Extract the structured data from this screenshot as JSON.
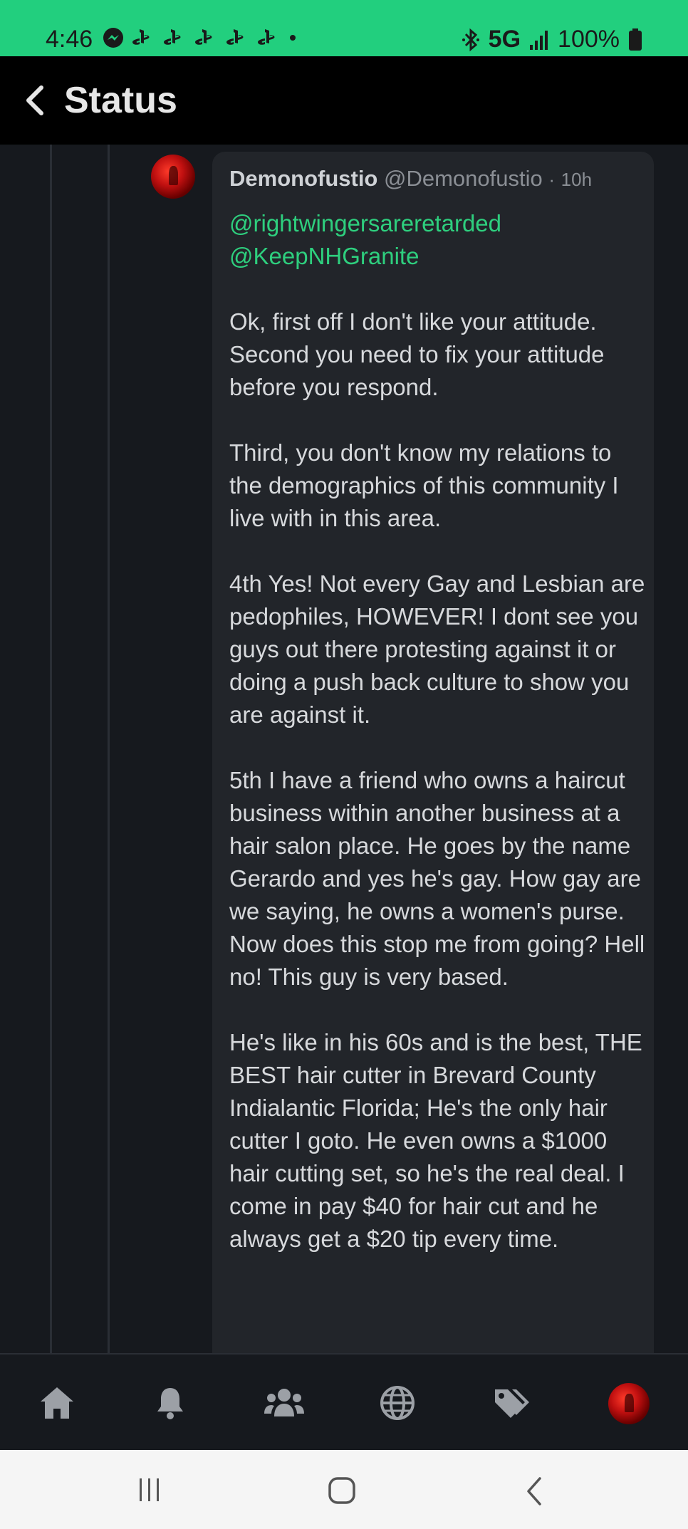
{
  "status_bar": {
    "time": "4:46",
    "network": "5G",
    "battery": "100%",
    "notification_icons": [
      "messenger-icon",
      "playstation-icon",
      "playstation-icon",
      "playstation-icon",
      "playstation-icon",
      "playstation-icon",
      "dot-icon"
    ]
  },
  "header": {
    "title": "Status",
    "back_icon": "chevron-left-icon"
  },
  "post": {
    "display_name": "Demonofustio",
    "handle": "@Demonofustio",
    "separator": "·",
    "age": "10h",
    "mentions": [
      "@rightwingersareretarded",
      "@KeepNHGranite"
    ],
    "paragraphs": [
      "Ok, first off I don't like your attitude. Second you need to fix your attitude before you respond.",
      "Third, you don't know my relations to the demographics of this community I live with in this area.",
      "4th Yes! Not every Gay and Lesbian are pedophiles, HOWEVER! I dont see you guys out there protesting against it or doing a push back culture to show you are against it.",
      "5th I have a friend who owns a haircut business within another business at a hair salon place. He goes by the name Gerardo and yes he's gay. How gay are we saying, he owns a women's purse. Now does this stop me from going? Hell no! This guy is very based.",
      "He's like in his 60s and is the best, THE BEST hair cutter in Brevard County",
      "Indialantic Florida; He's the only hair cutter I goto. He even owns a $1000 hair cutting set, so he's the real deal. I come in pay $40 for hair cut and he always get a $20 tip every time."
    ]
  },
  "bottom_nav": {
    "items": [
      "home-icon",
      "bell-icon",
      "users-icon",
      "globe-icon",
      "tags-icon",
      "profile-avatar"
    ]
  },
  "system_nav": {
    "items": [
      "recent-apps-icon",
      "home-circle-icon",
      "back-icon"
    ]
  },
  "colors": {
    "accent": "#22cf7e",
    "mention": "#2ecf7e",
    "background": "#16191e",
    "card": "#22252a"
  }
}
